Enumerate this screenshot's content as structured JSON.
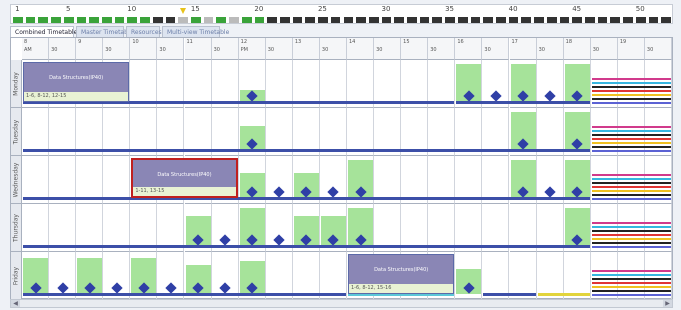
{
  "ruler": {
    "labels": [
      {
        "text": "1",
        "col": 1
      },
      {
        "text": "5",
        "col": 5
      },
      {
        "text": "10",
        "col": 10
      },
      {
        "text": "15",
        "col": 15
      },
      {
        "text": "20",
        "col": 20
      },
      {
        "text": "25",
        "col": 25
      },
      {
        "text": "30",
        "col": 30
      },
      {
        "text": "35",
        "col": 35
      },
      {
        "text": "40",
        "col": 40
      },
      {
        "text": "45",
        "col": 45
      },
      {
        "text": "50",
        "col": 50
      }
    ],
    "current_week": 14
  },
  "tabs": [
    {
      "label": "Combined Timetable",
      "active": true
    },
    {
      "label": "Master Timetable",
      "active": false
    },
    {
      "label": "Resources",
      "active": false
    },
    {
      "label": "Multi-view Timetable",
      "active": false
    }
  ],
  "hours": [
    {
      "hour": "8",
      "suffix": "AM"
    },
    {
      "hour": "9",
      "suffix": ""
    },
    {
      "hour": "10",
      "suffix": ""
    },
    {
      "hour": "11",
      "suffix": ""
    },
    {
      "hour": "12",
      "suffix": "PM"
    },
    {
      "hour": "13",
      "suffix": ""
    },
    {
      "hour": "14",
      "suffix": ""
    },
    {
      "hour": "15",
      "suffix": ""
    },
    {
      "hour": "16",
      "suffix": ""
    },
    {
      "hour": "17",
      "suffix": ""
    },
    {
      "hour": "18",
      "suffix": ""
    },
    {
      "hour": "19",
      "suffix": ""
    }
  ],
  "sub_label": "30",
  "days": [
    "Monday",
    "Tuesday",
    "Wednesday",
    "Thursday",
    "Friday"
  ],
  "courses": [
    {
      "day": 0,
      "start": 0,
      "span": 4,
      "title": "Data Structures(IP40)",
      "footer": "1-6, 8-12, 12-15",
      "selected": false
    },
    {
      "day": 2,
      "start": 4,
      "span": 4,
      "title": "Data Structures(IP40)",
      "footer": "1-11, 13-15",
      "selected": true
    },
    {
      "day": 4,
      "start": 12,
      "span": 4,
      "title": "Data Structures(IP40)",
      "footer": "1-6, 8-12, 15-16",
      "selected": false
    }
  ],
  "colors": {
    "availability_green": "#a6e39a",
    "marker_blue": "#2f3fa6",
    "selection_red": "#c0201f"
  }
}
